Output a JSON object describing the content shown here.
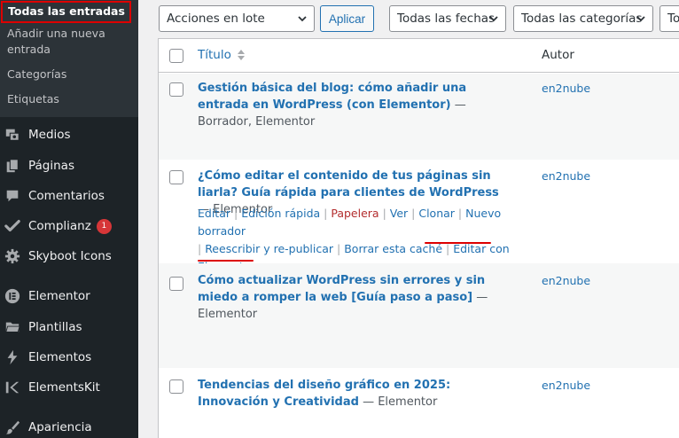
{
  "sidebar": {
    "submenu": [
      {
        "label": "Todas las entradas",
        "current": true
      },
      {
        "label": "Añadir una nueva entrada"
      },
      {
        "label": "Categorías"
      },
      {
        "label": "Etiquetas"
      }
    ],
    "menu": [
      {
        "label": "Medios",
        "icon": "media-icon"
      },
      {
        "label": "Páginas",
        "icon": "pages-icon"
      },
      {
        "label": "Comentarios",
        "icon": "comments-icon"
      },
      {
        "label": "Complianz",
        "icon": "check-icon",
        "badge": "1"
      },
      {
        "label": "Skyboot Icons",
        "icon": "gear-icon"
      },
      {
        "label": "Elementor",
        "icon": "elementor-icon"
      },
      {
        "label": "Plantillas",
        "icon": "folder-icon"
      },
      {
        "label": "Elementos",
        "icon": "bolt-icon"
      },
      {
        "label": "ElementsKit",
        "icon": "ek-icon"
      },
      {
        "label": "Apariencia",
        "icon": "brush-icon"
      }
    ]
  },
  "toolbar": {
    "bulk_actions": "Acciones en lote",
    "apply": "Aplicar",
    "dates": "Todas las fechas",
    "categories": "Todas las categorías",
    "extra": "To"
  },
  "table": {
    "col_title": "Título",
    "col_author": "Autor",
    "rows": [
      {
        "title": "Gestión básica del blog: cómo añadir una entrada en WordPress (con Elementor)",
        "state": " — Borrador, Elementor",
        "author": "en2nube"
      },
      {
        "title": "¿Cómo editar el contenido de tus páginas sin liarla? Guía rápida para clientes de WordPress",
        "state": " — Elementor",
        "author": "en2nube",
        "actions": {
          "edit": "Editar",
          "quick_edit": "Edición rápida",
          "trash": "Papelera",
          "view": "Ver",
          "clone": "Clonar",
          "new_draft": "Nuevo borrador",
          "rewrite": "Reescribir y re-publicar",
          "clear_cache": "Borrar esta caché",
          "edit_elementor": "Editar con Elementor"
        }
      },
      {
        "title": "Cómo actualizar WordPress sin errores y sin miedo a romper la web [Guía paso a paso]",
        "state": " — Elementor",
        "author": "en2nube"
      },
      {
        "title": "Tendencias del diseño gráfico en 2025: Innovación y Creatividad",
        "state": " — Elementor",
        "author": "en2nube"
      }
    ]
  },
  "colors": {
    "link": "#2271b1",
    "sidebar": "#1d2327",
    "highlight": "#dd0000",
    "trash": "#b32d2e"
  }
}
